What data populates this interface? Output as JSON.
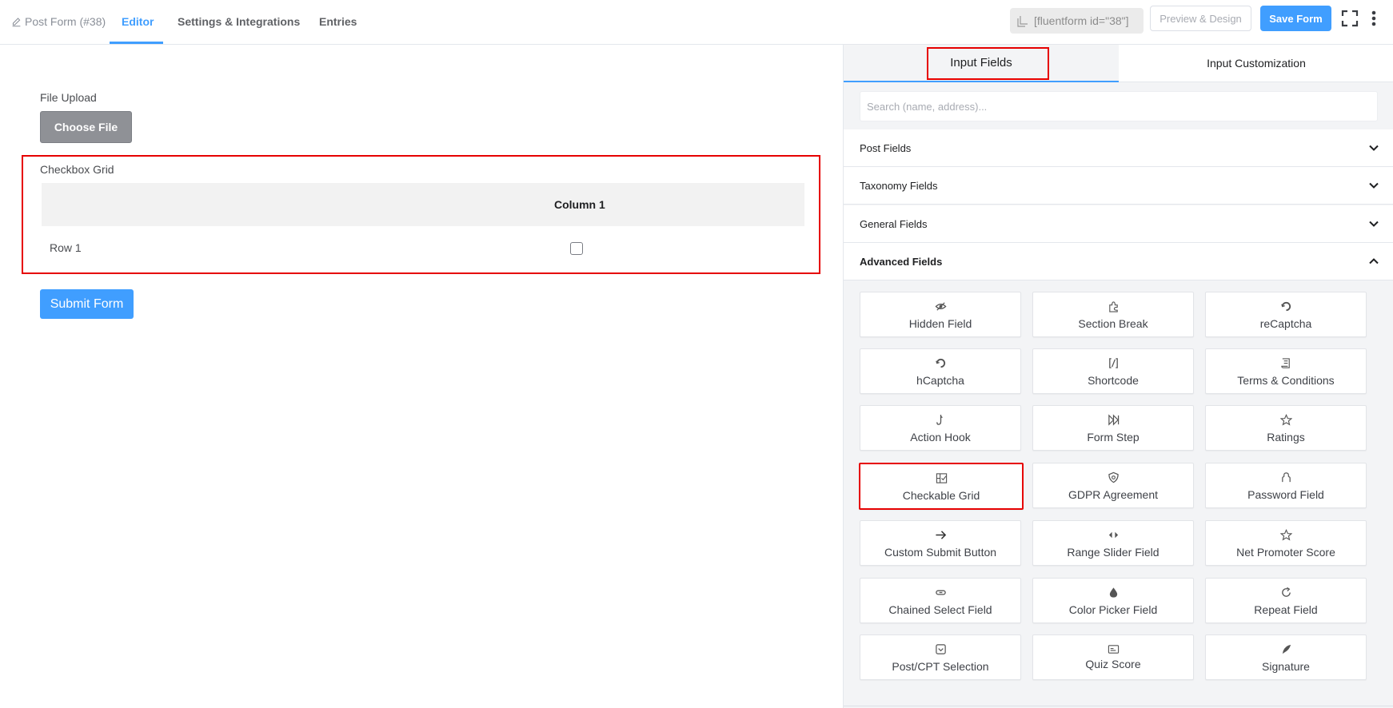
{
  "header": {
    "breadcrumb": "Post Form (#38)",
    "tabs": [
      {
        "label": "Editor",
        "active": true
      },
      {
        "label": "Settings & Integrations",
        "active": false
      },
      {
        "label": "Entries",
        "active": false
      }
    ],
    "shortcode": "[fluentform id=\"38\"]",
    "preview_label": "Preview & Design",
    "save_label": "Save Form",
    "fullscreen_icon": "fullscreen-icon",
    "more_icon": "more-vertical-icon"
  },
  "editor": {
    "file_upload_label": "File Upload",
    "choose_file_label": "Choose File",
    "checkbox_grid": {
      "label": "Checkbox Grid",
      "columns": [
        "Column 1"
      ],
      "rows": [
        "Row 1"
      ]
    },
    "submit_label": "Submit Form"
  },
  "panel": {
    "tabs": [
      "Input Fields",
      "Input Customization"
    ],
    "search_placeholder": "Search (name, address)...",
    "sections": [
      {
        "label": "Post Fields",
        "open": false
      },
      {
        "label": "Taxonomy Fields",
        "open": false
      },
      {
        "label": "General Fields",
        "open": false
      },
      {
        "label": "Advanced Fields",
        "open": true
      }
    ],
    "advanced_fields": [
      {
        "label": "Hidden Field",
        "icon": "eye-slash-icon"
      },
      {
        "label": "Section Break",
        "icon": "puzzle-icon"
      },
      {
        "label": "reCaptcha",
        "icon": "recaptcha-icon"
      },
      {
        "label": "hCaptcha",
        "icon": "hcaptcha-icon"
      },
      {
        "label": "Shortcode",
        "icon": "shortcode-icon"
      },
      {
        "label": "Terms & Conditions",
        "icon": "scroll-icon"
      },
      {
        "label": "Action Hook",
        "icon": "hook-icon"
      },
      {
        "label": "Form Step",
        "icon": "step-forward-icon"
      },
      {
        "label": "Ratings",
        "icon": "star-icon"
      },
      {
        "label": "Checkable Grid",
        "icon": "grid-check-icon"
      },
      {
        "label": "GDPR Agreement",
        "icon": "shield-icon"
      },
      {
        "label": "Password Field",
        "icon": "lock-icon"
      },
      {
        "label": "Custom Submit Button",
        "icon": "arrow-right-icon"
      },
      {
        "label": "Range Slider Field",
        "icon": "range-arrows-icon"
      },
      {
        "label": "Net Promoter Score",
        "icon": "star-outline-icon"
      },
      {
        "label": "Chained Select Field",
        "icon": "link-icon"
      },
      {
        "label": "Color Picker Field",
        "icon": "droplet-icon"
      },
      {
        "label": "Repeat Field",
        "icon": "repeat-icon"
      },
      {
        "label": "Post/CPT Selection",
        "icon": "post-select-icon"
      },
      {
        "label": "Quiz Score",
        "icon": "quiz-icon"
      },
      {
        "label": "Signature",
        "icon": "pen-icon"
      }
    ]
  },
  "colors": {
    "accent": "#409eff",
    "highlight": "#e60000"
  }
}
